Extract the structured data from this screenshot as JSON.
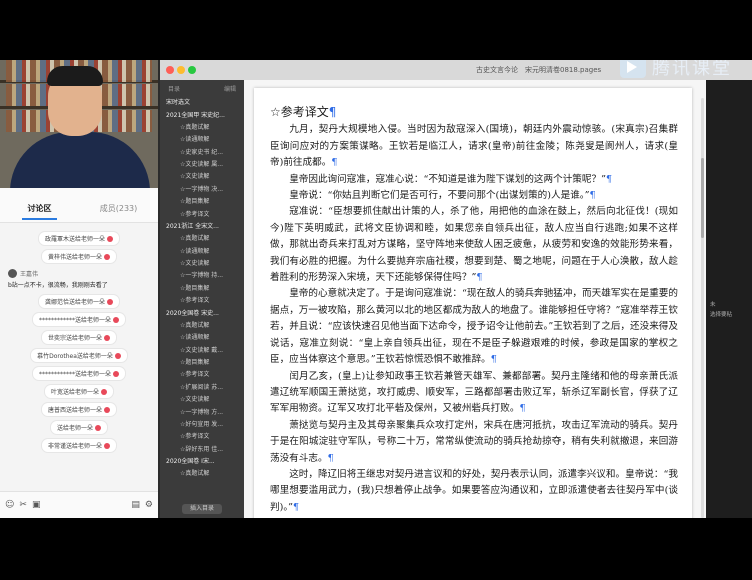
{
  "window": {
    "title": "古史文言今论　宋元明清卷0818.pages"
  },
  "brand": {
    "name": "腾讯课堂"
  },
  "chat": {
    "tabs": [
      {
        "label": "讨论区"
      },
      {
        "label": "成员(233)"
      }
    ],
    "items": [
      {
        "type": "gift",
        "text": "政羅軍木送给老师一朵"
      },
      {
        "type": "gift",
        "text": "黄梓伟送给老师一朵"
      },
      {
        "type": "message",
        "user": "王嘉伟",
        "text": "b站一点不卡，很流畅，我刚刚去看了"
      },
      {
        "type": "gift",
        "text": "龚娜范恰送给老师一朵"
      },
      {
        "type": "gift",
        "text": "************送给老师一朵"
      },
      {
        "type": "gift",
        "text": "世奕宗送给老师一朵"
      },
      {
        "type": "gift",
        "text": "慕竹Dorothea送给老师一朵"
      },
      {
        "type": "gift",
        "text": "************送给老师一朵"
      },
      {
        "type": "gift",
        "text": "叶宽送给老师一朵"
      },
      {
        "type": "gift",
        "text": "唐普西送给老师一朵"
      },
      {
        "type": "gift",
        "text": "送给老师一朵"
      },
      {
        "type": "gift",
        "text": "非常谨送给老师一朵"
      }
    ]
  },
  "sidebar": {
    "top_left": "目录",
    "top_right": "编辑",
    "items": [
      {
        "level": 1,
        "label": "宋时选文"
      },
      {
        "level": 1,
        "label": "2021全国甲 宋史纪..."
      },
      {
        "level": 2,
        "label": "☆真题试解"
      },
      {
        "level": 2,
        "label": "☆读通顺解"
      },
      {
        "level": 2,
        "label": "☆史家史书 纪..."
      },
      {
        "level": 2,
        "label": "☆文史读解 属..."
      },
      {
        "level": 2,
        "label": "☆文史读解"
      },
      {
        "level": 2,
        "label": "☆一字博物 决..."
      },
      {
        "level": 2,
        "label": "☆题目集解"
      },
      {
        "level": 2,
        "label": "☆参考译文"
      },
      {
        "level": 1,
        "label": "2021浙江 全宋文..."
      },
      {
        "level": 2,
        "label": "☆真题试解"
      },
      {
        "level": 2,
        "label": "☆读通顺解"
      },
      {
        "level": 2,
        "label": "☆文史读解"
      },
      {
        "level": 2,
        "label": "☆一字博物 持..."
      },
      {
        "level": 2,
        "label": "☆题目集解"
      },
      {
        "level": 2,
        "label": "☆参考译文"
      },
      {
        "level": 1,
        "label": "2020全国卷 宋史..."
      },
      {
        "level": 2,
        "label": "☆真题试解"
      },
      {
        "level": 2,
        "label": "☆读通顺解"
      },
      {
        "level": 2,
        "label": "☆文史读解 戴..."
      },
      {
        "level": 2,
        "label": "☆题目集解"
      },
      {
        "level": 2,
        "label": "☆参考译文"
      },
      {
        "level": 2,
        "label": "☆扩展阅读 苏..."
      },
      {
        "level": 2,
        "label": "☆文史读解"
      },
      {
        "level": 2,
        "label": "☆一字博物 方..."
      },
      {
        "level": 2,
        "label": "☆好句宣用 发..."
      },
      {
        "level": 2,
        "label": "☆参考译文"
      },
      {
        "level": 2,
        "label": "☆辞好东用 佳..."
      },
      {
        "level": 1,
        "label": "2020全国卷 Ⅰ宋..."
      },
      {
        "level": 2,
        "label": "☆真题试解"
      }
    ],
    "bottom_button": "插入目录"
  },
  "document": {
    "heading": "☆参考译文",
    "paragraphs": [
      "九月，契丹大规模地入侵。当时因为敌寇深入(国境)，朝廷内外震动惊骇。(宋真宗)召集群臣询问应对的方案策谋略。王钦若是临江人，请求(皇帝)前往金陵；陈尧叟是阆州人，请求(皇帝)前往成都。",
      "皇帝因此询问寇准，寇准心说：“不知道是谁为陛下谋划的这两个计策呢？”",
      "皇帝说：“你姑且判断它们是否可行，不要问那个(出谋划策的)人是谁。”",
      "寇准说：“臣想要抓住献出计策的人，杀了他，用把他的血涂在鼓上，然后向北征伐！(现如今)陛下英明威武，武将文臣协调和睦，如果您亲自领兵出征，敌人应当自行逃跑;如果不这样做，那就出奇兵来打乱对方谋略，坚守阵地来使敌人困乏疲惫，从疲劳和安逸的效能形势来看，我们有必胜的把握。为什么要抛弃宗庙社稷，想要到楚、蜀之地呢，问题在于人心涣散，敌人趁着胜利的形势深入宋境，天下还能够保得住吗？”",
      "皇帝的心意就决定了。于是询问寇准说：“现在敌人的骑兵奔驰猛冲，而天雄军实在是重要的据点，万一被攻陷，那么黄河以北的地区都成为敌人的地盘了。谁能够担任守将？”寇准举荐王钦若，并且说：“应该快速召见他当面下达命令，授予诏令让他前去。”王钦若到了之后，还没来得及说话，寇准立刻说：“皇上亲自领兵出征，现在不是臣子躲避艰难的时候，参政是国家的掌权之臣，应当体察这个意思。”王钦若惊慌恐惧不敢推辞。",
      "闰月乙亥，(皇上)让参知政事王钦若兼管天雄军、兼都部署。契丹主隆绪和他的母亲萧氏派遣辽统军顺国王萧挞览，攻打威虏、顺安军，三路都部署击败辽军，斩杀辽军副长官，俘获了辽军军用物资。辽军又攻打北平砦及保州，又被州砦兵打败。",
      "萧挞览与契丹主及其母亲聚集兵众攻打定州，宋兵在唐河抵抗，攻击辽军流动的骑兵。契丹于是在阳城淀驻守军队，号称二十万，常常纵使流动的骑兵抢劫掠夺，稍有失利就撤退，来回游荡没有斗志。",
      "这时，降辽旧将王继忠对契丹进言议和的好处，契丹表示认同，派遣李兴议和。皇帝说：“我哪里想要滥用武力，(我)只想着停止战争。如果要答应沟通议和，立即派遣使者去往契丹军中(谈判)。”"
    ]
  },
  "right_strip": {
    "line1": "未",
    "line2": "选择要粘"
  }
}
